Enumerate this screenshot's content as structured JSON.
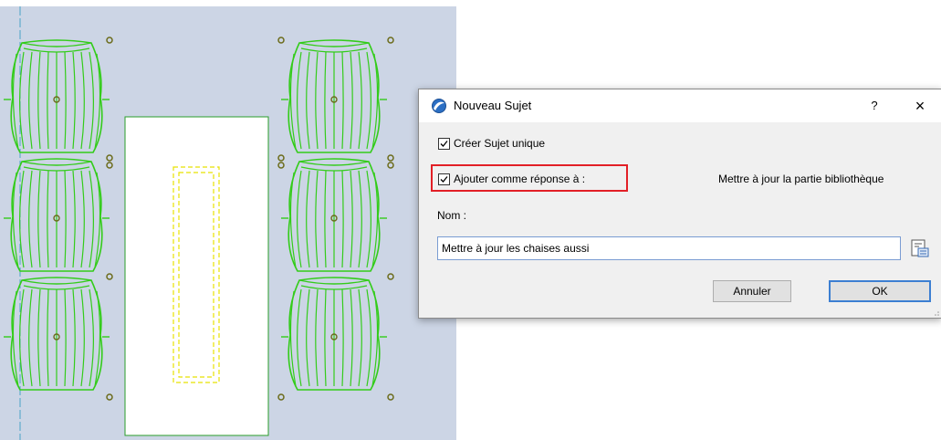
{
  "dialog": {
    "title": "Nouveau Sujet",
    "help_label": "?",
    "close_label": "×",
    "option_single": {
      "label": "Créer Sujet unique",
      "checked": true
    },
    "option_reply": {
      "label": "Ajouter comme réponse à :",
      "checked": true
    },
    "reply_target": "Mettre à jour la partie bibliothèque",
    "name_label": "Nom :",
    "name_value": "Mettre à jour les chaises aussi",
    "cancel_label": "Annuler",
    "ok_label": "OK"
  },
  "colors": {
    "canvas_background": "#ccd5e5",
    "chair_lines": "#33cc1a",
    "table_outline": "#2a9d2a",
    "dashed_rectangle": "#e8e200",
    "markers": "#6b6b1a",
    "highlight_border": "#e21f26",
    "ok_border": "#3c7fd2"
  },
  "icons": {
    "app": "archicad-globe-icon",
    "browse": "library-browse-icon"
  }
}
